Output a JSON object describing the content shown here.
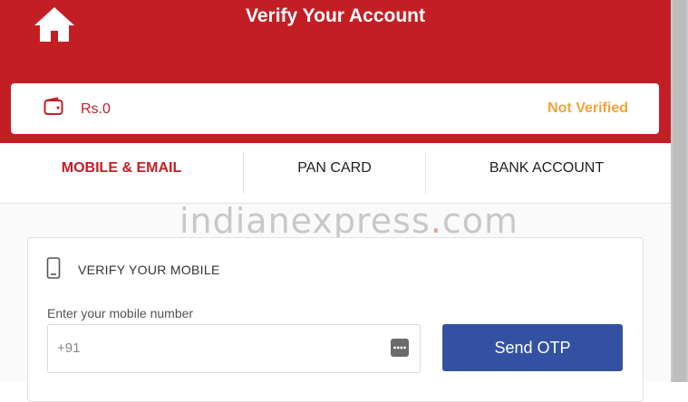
{
  "header": {
    "title": "Verify Your Account",
    "home_icon": "home-icon"
  },
  "wallet": {
    "icon": "wallet-icon",
    "balance": "Rs.0",
    "status": "Not Verified"
  },
  "tabs": [
    {
      "label": "MOBILE & EMAIL",
      "active": true
    },
    {
      "label": "PAN CARD",
      "active": false
    },
    {
      "label": "BANK ACCOUNT",
      "active": false
    }
  ],
  "watermark": {
    "left": "indianexpress",
    "dot": ".",
    "right": "com"
  },
  "verify_mobile": {
    "icon": "phone-icon",
    "title": "VERIFY YOUR MOBILE",
    "field_label": "Enter your mobile number",
    "input_placeholder": "+91",
    "input_value": "",
    "keypad_icon": "keypad-icon",
    "button_label": "Send OTP"
  },
  "colors": {
    "brand_red": "#c41e25",
    "status_orange": "#f0a43a",
    "button_blue": "#3451a1"
  }
}
